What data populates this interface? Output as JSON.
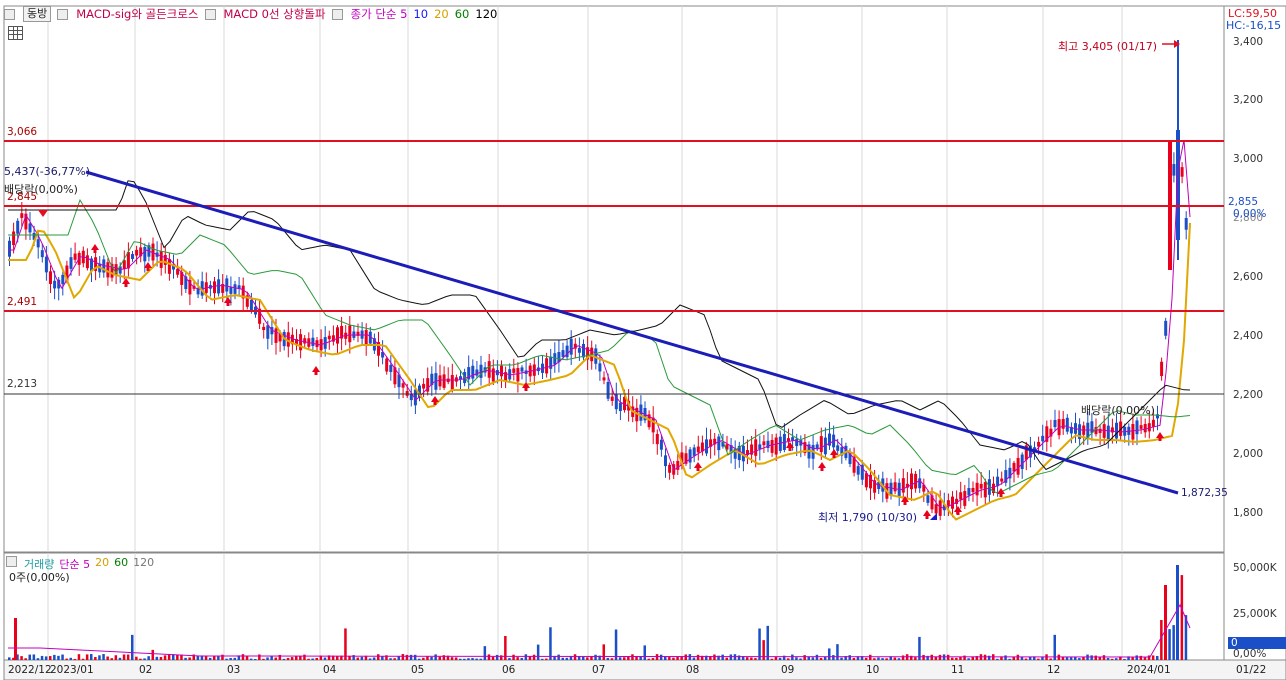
{
  "toolbar": {
    "mode_button": "동방",
    "indicators": [
      {
        "label": "MACD-sig와 골든크로스",
        "color": "#c0004a"
      },
      {
        "label": "MACD 0선 상향돌파",
        "color": "#c0004a"
      },
      {
        "label": "종가 단순 5",
        "color": "#c000c0"
      }
    ],
    "ma_periods": [
      {
        "label": "10",
        "color": "#1a1aff"
      },
      {
        "label": "20",
        "color": "#d4a000"
      },
      {
        "label": "60",
        "color": "#008000"
      },
      {
        "label": "120",
        "color": "#000000"
      }
    ]
  },
  "header_right": {
    "lc": "LC:59,50",
    "hc": "HC:-16,15"
  },
  "price_axis": {
    "ticks": [
      "3,400",
      "3,200",
      "3,000",
      "2,800",
      "2,600",
      "2,400",
      "2,200",
      "2,000",
      "1,800"
    ],
    "current_price": "2,855",
    "current_pct": "0,00%"
  },
  "levels": {
    "level1": "3,066",
    "level2": "2,845",
    "level3": "2,491",
    "level4": "2,213"
  },
  "annotations": {
    "high": "최고 3,405 (01/17)",
    "low": "최저 1,790 (10/30)",
    "dividend_left": "배당락(0,00%)",
    "dividend_right": "배당락(0,00%)",
    "trend_start": "5,437(-36,77%)",
    "trend_end": "1,872,35"
  },
  "volume_panel": {
    "legend_label": "거래량",
    "legend_type": "단순 5",
    "periods": [
      {
        "label": "20",
        "color": "#d4a000"
      },
      {
        "label": "60",
        "color": "#008000"
      },
      {
        "label": "120",
        "color": "#777777"
      }
    ],
    "info": "0주(0,00%)",
    "ticks": [
      "50,000K",
      "25,000K",
      "0,00%"
    ],
    "current_badge": "0"
  },
  "x_axis": [
    "2022/12",
    "2023/01",
    "02",
    "03",
    "04",
    "05",
    "06",
    "07",
    "08",
    "09",
    "10",
    "11",
    "12",
    "2024/01",
    "01/22"
  ],
  "colors": {
    "up": "#e8001c",
    "down": "#1a4fc8",
    "trend": "#1c1cb8",
    "level": "#e01020",
    "ma5": "#c000c0",
    "ma20": "#e0a800",
    "ma60": "#2a9a3a",
    "ma120": "#111111"
  }
}
